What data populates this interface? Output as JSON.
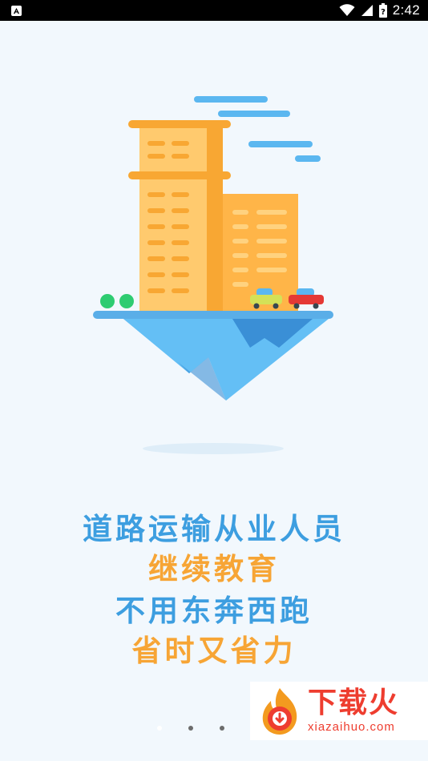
{
  "status_bar": {
    "time": "2:42",
    "icons": [
      "notification-icon",
      "wifi-icon",
      "cell-signal-icon",
      "battery-icon"
    ],
    "battery_label": "?"
  },
  "intro": {
    "slogan_lines": [
      "道路运输从业人员",
      "继续教育",
      "不用东奔西跑",
      "省时又省力"
    ],
    "page_indicator": {
      "count": 3,
      "active_index": 0
    }
  },
  "watermark": {
    "title": "下载火",
    "url": "xiazaihuo.com"
  },
  "colors": {
    "background": "#f2f8fd",
    "blue": "#3d9ee0",
    "orange": "#f7a535",
    "watermark_red": "#ee3d2f"
  }
}
